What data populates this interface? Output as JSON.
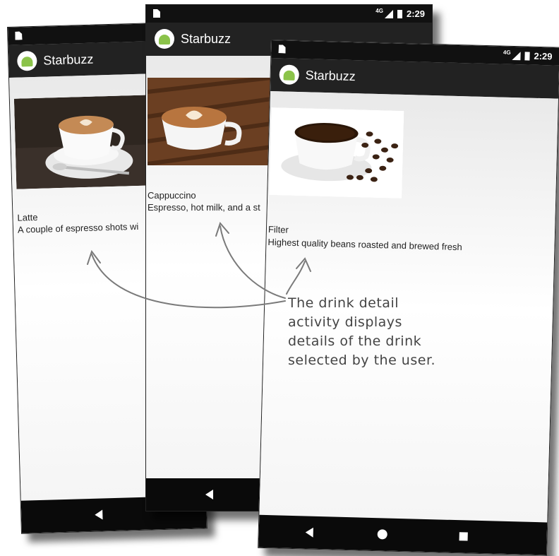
{
  "app": {
    "title": "Starbuzz",
    "time": "2:29",
    "network": "4G"
  },
  "screens": [
    {
      "name": "Latte",
      "description": "A couple of espresso shots wi"
    },
    {
      "name": "Cappuccino",
      "description": "Espresso, hot milk, and a st"
    },
    {
      "name": "Filter",
      "description": "Highest quality beans roasted and brewed fresh"
    }
  ],
  "annotation": {
    "lines": [
      "The drink detail",
      "activity displays",
      "details of the drink",
      "selected by the user."
    ]
  },
  "colors": {
    "appbar": "#222222",
    "statusbar": "#111111",
    "navbar": "#0a0a0a",
    "android": "#8bc34a",
    "annotation": "#444444"
  }
}
